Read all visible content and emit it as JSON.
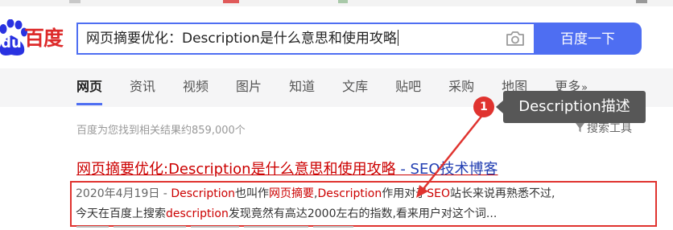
{
  "logo": {
    "du_text": "du",
    "brand_text": "百度"
  },
  "search": {
    "query": "网页摘要优化：Description是什么意思和使用攻略",
    "button_label": "百度一下"
  },
  "tabs": [
    {
      "label": "网页",
      "active": true
    },
    {
      "label": "资讯"
    },
    {
      "label": "视频"
    },
    {
      "label": "图片"
    },
    {
      "label": "知道"
    },
    {
      "label": "文库"
    },
    {
      "label": "贴吧"
    },
    {
      "label": "采购"
    },
    {
      "label": "地图"
    },
    {
      "label": "更多",
      "suffix": "»"
    }
  ],
  "results_info": {
    "stats": "百度为您找到相关结果约859,000个",
    "search_tools": "搜索工具"
  },
  "result": {
    "title_main": "网页摘要优化:Description是什么意思和使用攻略",
    "title_tail": " - SEO技术博客",
    "date": "2020年4月19日",
    "sep": " - ",
    "line1": [
      {
        "t": "Description",
        "em": true
      },
      {
        "t": "也叫作"
      },
      {
        "t": "网页摘要",
        "em": true
      },
      {
        "t": ","
      },
      {
        "t": "Description",
        "em": true
      },
      {
        "t": "作用对于"
      },
      {
        "t": "SEO",
        "em": true
      },
      {
        "t": "站长来说再熟悉不过,"
      }
    ],
    "line2": [
      {
        "t": "今天在百度上搜索"
      },
      {
        "t": "description",
        "em": true
      },
      {
        "t": "发现竟然有高达2000左右的指数,看来用户对这个词..."
      }
    ]
  },
  "annotation": {
    "number": "1",
    "label": "Description描述"
  },
  "colors": {
    "baidu_blue": "#4e6ef2",
    "baidu_red": "#dd2a2a",
    "highlight_red": "#e0332f",
    "callout_gray": "#575757"
  }
}
